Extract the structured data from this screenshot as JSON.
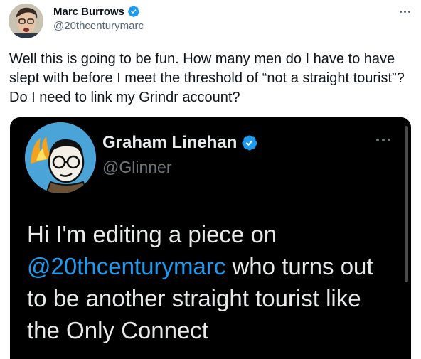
{
  "tweet": {
    "author_name": "Marc Burrows",
    "author_handle": "@20thcenturymarc",
    "text": "Well this is going to be fun. How many men do I have to have slept with before I meet the threshold of “not a straight tourist”? Do I need to link my Grindr account?"
  },
  "embedded": {
    "author_name": "Graham Linehan",
    "author_handle": "@Glinner",
    "text_before": "Hi I'm editing a piece on ",
    "mention": "@20thcenturymarc",
    "text_after": " who turns out to be another straight tourist like the Only Connect"
  },
  "colors": {
    "verified": "#1d9bf0",
    "mention": "#1d9bf0",
    "embed_bg": "#000000"
  },
  "icons": {
    "verified": "verified-badge-icon",
    "more": "more-options-icon"
  }
}
